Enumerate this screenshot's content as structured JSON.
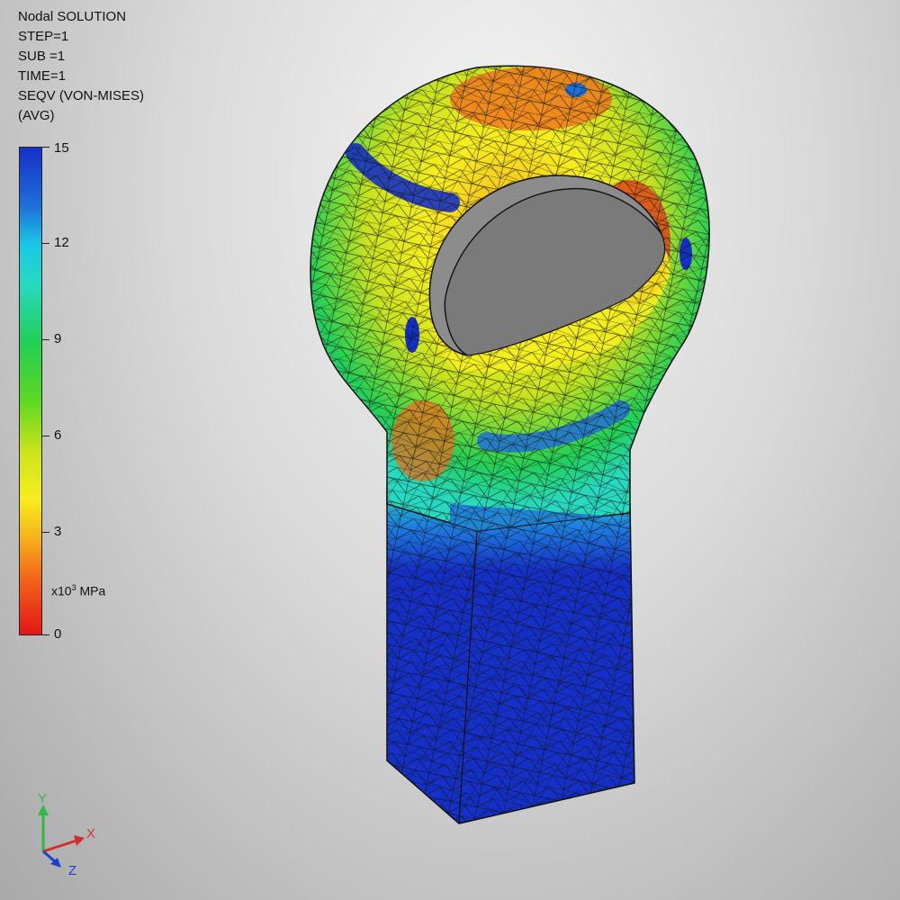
{
  "info": {
    "title": "Nodal SOLUTION",
    "step": "STEP=1",
    "sub": "SUB =1",
    "time": "TIME=1",
    "result": "SEQV (VON-MISES)",
    "avg": "(AVG)"
  },
  "legend": {
    "ticks": [
      "15",
      "12",
      "9",
      "6",
      "3",
      "0"
    ],
    "unit_prefix": "x10",
    "unit_exp": "3",
    "unit_suffix": " MPa",
    "colors": {
      "max": "#1530c8",
      "mid": "#22cf55",
      "low": "#f7ee1c",
      "min": "#e41515"
    }
  },
  "triad": {
    "y": "Y",
    "x": "X",
    "z": "Z"
  }
}
